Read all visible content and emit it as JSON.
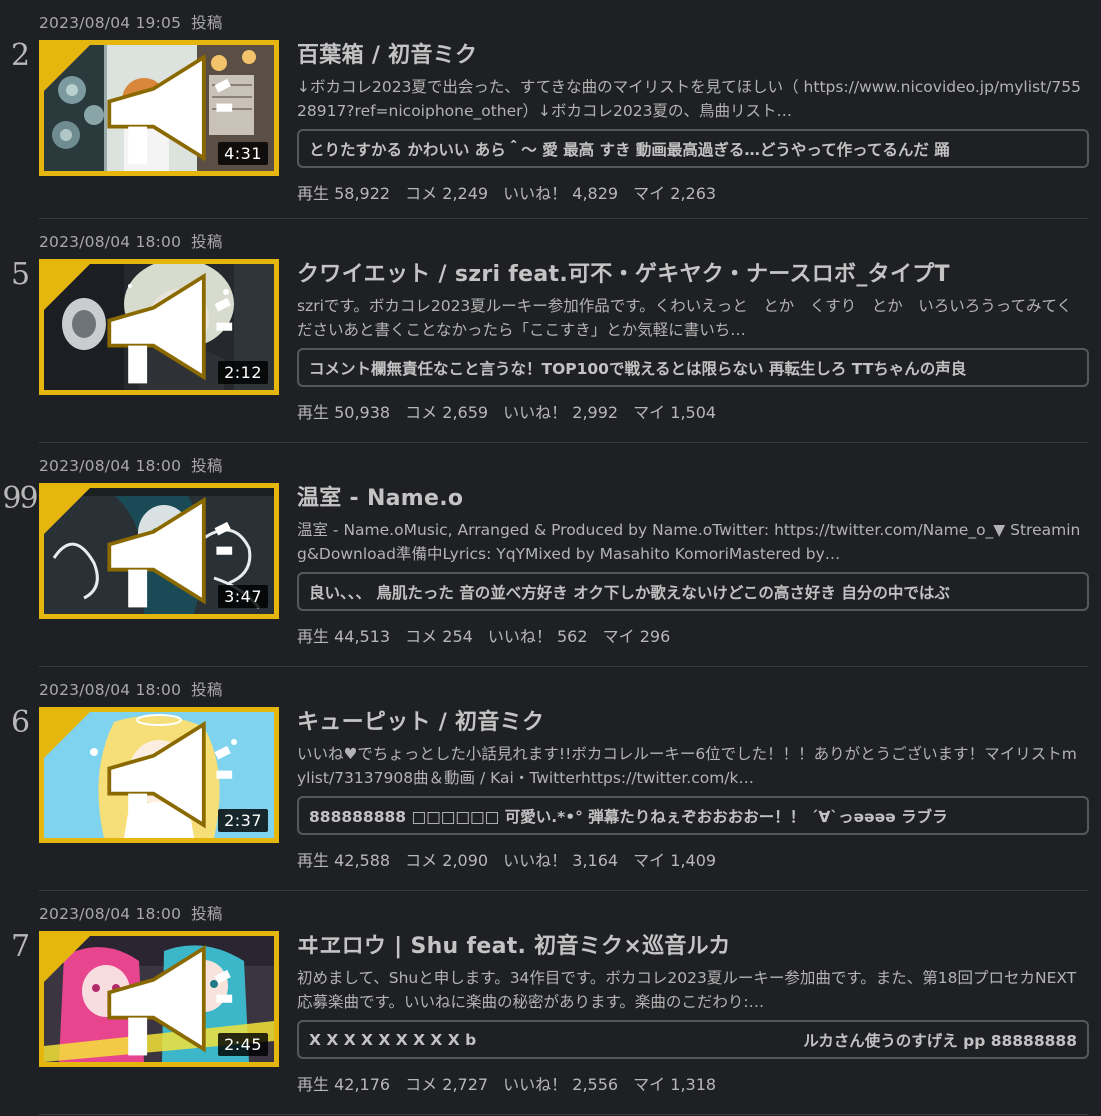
{
  "items": [
    {
      "date": "2023/08/04 19:05",
      "posted": "投稿",
      "rank": "2",
      "duration": "4:31",
      "title": "百葉箱 / 初音ミク",
      "description": "↓ボカコレ2023夏で出会った、すてきな曲のマイリストを見てほしい（ https://www.nicovideo.jp/mylist/75528917?ref=nicoiphone_other）↓ボカコレ2023夏の、鳥曲リスト…",
      "comments": "とりたすかる かわいい あら＾～ 愛 最高 すき 動画最高過ぎる…どうやって作ってるんだ 踊",
      "comments_right": "",
      "stats": {
        "plays": "再生 58,922",
        "comments": "コメ 2,249",
        "likes": "いいね！ 4,829",
        "mylist": "マイ 2,263"
      }
    },
    {
      "date": "2023/08/04 18:00",
      "posted": "投稿",
      "rank": "5",
      "duration": "2:12",
      "title": "クワイエット / szri feat.可不・ゲキヤク・ナースロボ_タイプT",
      "description": "szriです。ボカコレ2023夏ルーキー参加作品です。くわいえっと　とか　くすり　とか　いろいろうってみてくださいあと書くことなかったら「ここすき」とか気軽に書いち…",
      "comments": "コメント欄無責任なこと言うな！TOP100で戦えるとは限らない 再転生しろ TTちゃんの声良",
      "comments_right": "",
      "stats": {
        "plays": "再生 50,938",
        "comments": "コメ 2,659",
        "likes": "いいね！ 2,992",
        "mylist": "マイ 1,504"
      }
    },
    {
      "date": "2023/08/04 18:00",
      "posted": "投稿",
      "rank": "99",
      "duration": "3:47",
      "title": "温室 - Name.o",
      "description": "温室 - Name.oMusic, Arranged & Produced by Name.oTwitter: https://twitter.com/Name_o_▼ Streaming&Download準備中Lyrics: YqYMixed by Masahito KomoriMastered by…",
      "comments": "良い、、、 鳥肌たった 音の並べ方好き オク下しか歌えないけどこの高さ好き 自分の中ではぶ",
      "comments_right": "",
      "stats": {
        "plays": "再生 44,513",
        "comments": "コメ 254",
        "likes": "いいね！ 562",
        "mylist": "マイ 296"
      }
    },
    {
      "date": "2023/08/04 18:00",
      "posted": "投稿",
      "rank": "6",
      "duration": "2:37",
      "title": "キューピット / 初音ミク",
      "description": "いいね♥でちょっとした小話見れます!!ボカコレルーキー6位でした！！！ありがとうございます！マイリストmylist/73137908曲＆動画 / Kai・Twitterhttps://twitter.com/k…",
      "comments": "888888888 □□□□□□ 可愛い.*•° 弾幕たりねぇぞおおおおー！！ ´∀`っəəəə ラブラ",
      "comments_right": "",
      "stats": {
        "plays": "再生 42,588",
        "comments": "コメ 2,090",
        "likes": "いいね！ 3,164",
        "mylist": "マイ 1,409"
      }
    },
    {
      "date": "2023/08/04 18:00",
      "posted": "投稿",
      "rank": "7",
      "duration": "2:45",
      "title": "ヰヱロウ | Shu feat. 初音ミク×巡音ルカ",
      "description": "初めまして、Shuと申します。34作目です。ボカコレ2023夏ルーキー参加曲です。また、第18回プロセカNEXT応募楽曲です。いいねに楽曲の秘密があります。楽曲のこだわり:…",
      "comments": "X X X X X X X X X b",
      "comments_right": "ルカさん使うのすげえ pp 88888888",
      "stats": {
        "plays": "再生 42,176",
        "comments": "コメ 2,727",
        "likes": "いいね！ 2,556",
        "mylist": "マイ 1,318"
      }
    }
  ],
  "icons": {
    "badge": "megaphone-icon"
  },
  "colors": {
    "background": "#1f2023",
    "accent_gold": "#e4b60e",
    "divider": "#3a3b3e"
  }
}
